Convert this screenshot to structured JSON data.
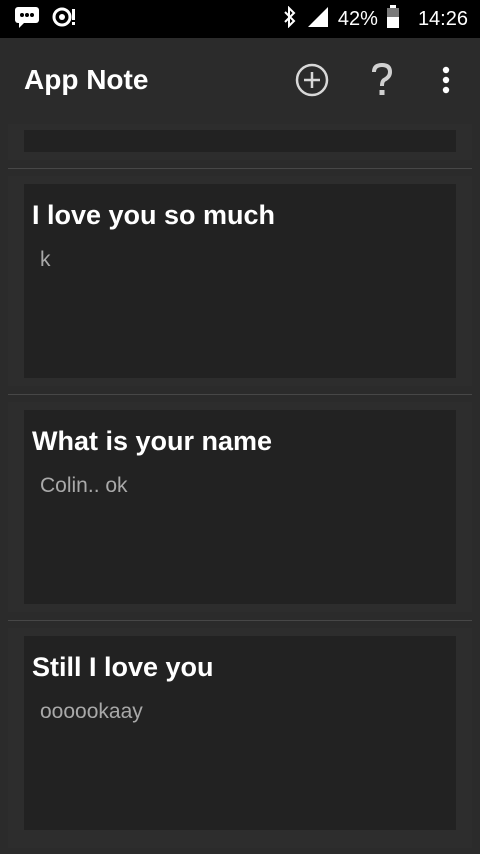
{
  "status_bar": {
    "battery_percent": "42%",
    "time": "14:26",
    "icons": [
      "chat-notification-icon",
      "app-notification-icon",
      "bluetooth-icon",
      "signal-icon",
      "battery-icon"
    ]
  },
  "app_bar": {
    "title": "App Note",
    "actions": [
      "add-circle-icon",
      "help-icon",
      "overflow-menu-icon"
    ]
  },
  "notes": [
    {
      "title": "",
      "body": ""
    },
    {
      "title": "I love you so much",
      "body": "k"
    },
    {
      "title": "What is your name",
      "body": "Colin.. ok"
    },
    {
      "title": "Still I love you",
      "body": "oooookaay"
    }
  ],
  "colors": {
    "background": "#2b2b2b",
    "card": "#222222",
    "status_bar": "#000000",
    "title_text": "#ffffff",
    "body_text": "#a9a9a9"
  }
}
